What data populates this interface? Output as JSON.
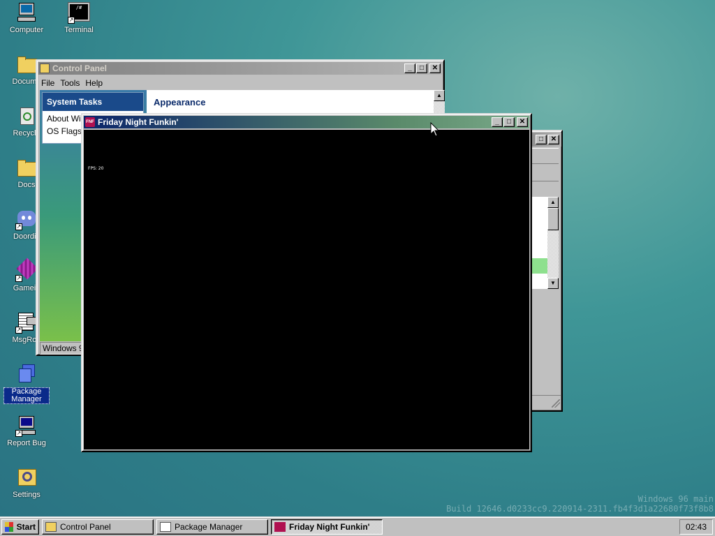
{
  "desktop": {
    "icons": [
      {
        "label": "Computer",
        "icon": "computer-icon"
      },
      {
        "label": "Terminal",
        "icon": "terminal-icon"
      },
      {
        "label": "Docume",
        "icon": "folder-documents-icon"
      },
      {
        "label": "Recycle",
        "icon": "recycle-bin-icon"
      },
      {
        "label": "Docs",
        "icon": "folder-icon"
      },
      {
        "label": "Doordis",
        "icon": "chat-app-icon"
      },
      {
        "label": "Gamein",
        "icon": "game-icon"
      },
      {
        "label": "MsgRoo",
        "icon": "message-room-icon"
      },
      {
        "label": "Package Manager",
        "icon": "package-manager-icon"
      },
      {
        "label": "Report Bug",
        "icon": "report-bug-icon"
      },
      {
        "label": "Settings",
        "icon": "settings-icon"
      }
    ],
    "watermark_line1": "Windows 96 main",
    "watermark_line2": "Build 12646.d0233cc9.220914-2311.fb4f3d1a22680f73f8b8"
  },
  "control_panel": {
    "title": "Control Panel",
    "menu": [
      "File",
      "Tools",
      "Help"
    ],
    "system_tasks_header": "System Tasks",
    "tasks": [
      "About Win",
      "OS Flags"
    ],
    "section_title": "Appearance",
    "status": "Windows 96"
  },
  "game_window": {
    "title": "Friday Night Funkin'",
    "fps_text": "FPS: 20"
  },
  "taskbar": {
    "start": "Start",
    "items": [
      "Control Panel",
      "Package Manager",
      "Friday Night Funkin'"
    ],
    "clock": "02:43"
  },
  "colors": {
    "active_title": "#0a246a",
    "desktop": "#3f9697",
    "highlight": "#8ee08e"
  }
}
